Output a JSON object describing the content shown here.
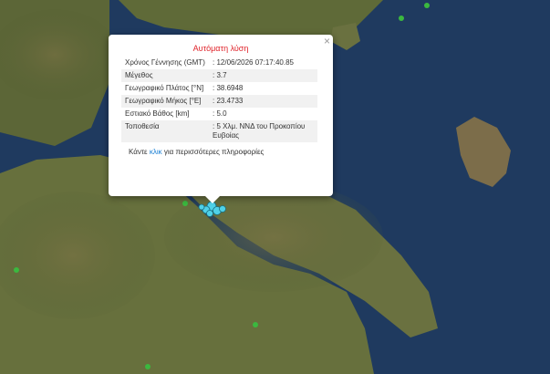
{
  "popup": {
    "title": "Αυτόματη λύση",
    "close_icon": "close-icon",
    "rows": [
      {
        "label": "Χρόνος Γέννησης (GMT)",
        "value": "12/06/2026 07:17:40.85"
      },
      {
        "label": "Μέγεθος",
        "value": "3.7"
      },
      {
        "label": "Γεωγραφικό Πλάτος [°N]",
        "value": "38.6948"
      },
      {
        "label": "Γεωγραφικό Μήκος [°E]",
        "value": "23.4733"
      },
      {
        "label": "Εστιακό Βάθος [km]",
        "value": "5.0"
      },
      {
        "label": "Τοποθεσία",
        "value": "5 Χλμ. ΝΝΔ του Προκοπίου Ευβοίας"
      }
    ],
    "more_prefix": "Κάντε",
    "more_link": "κλικ",
    "more_suffix": "για περισσότερες πληροφορίες"
  },
  "map": {
    "colors": {
      "sea": "#1f3a5f",
      "land": "#6b6f3e",
      "mountain": "#7e6f52",
      "epicenter": "#4fd1e8",
      "station": "#3bb83f"
    }
  }
}
